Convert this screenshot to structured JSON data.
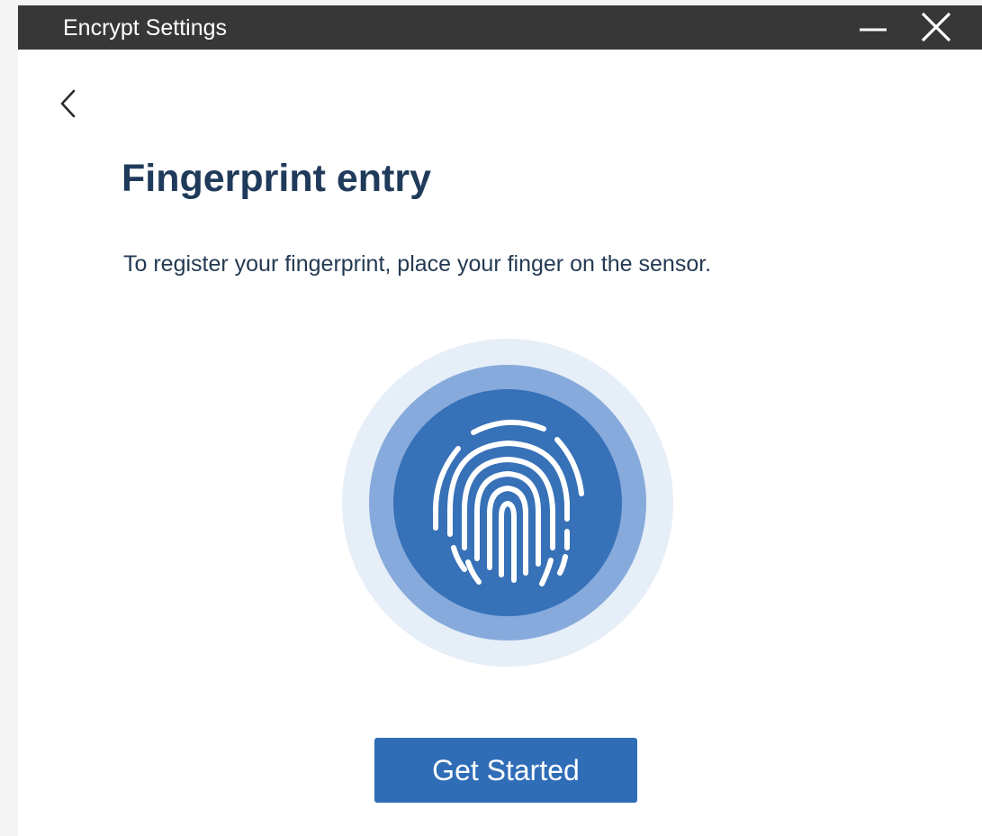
{
  "window": {
    "title": "Encrypt Settings"
  },
  "navigation": {
    "back_icon": "chevron-left-icon"
  },
  "main": {
    "heading": "Fingerprint entry",
    "instruction": "To register your fingerprint, place your finger on the sensor.",
    "illustration_icon": "fingerprint-icon",
    "primary_button_label": "Get Started"
  },
  "colors": {
    "titlebar": "#373737",
    "heading": "#1f3a5a",
    "accent": "#2f6db7",
    "ring_outer": "#e6eef8",
    "ring_mid": "#86aadb",
    "ring_inner": "#3771b8"
  }
}
